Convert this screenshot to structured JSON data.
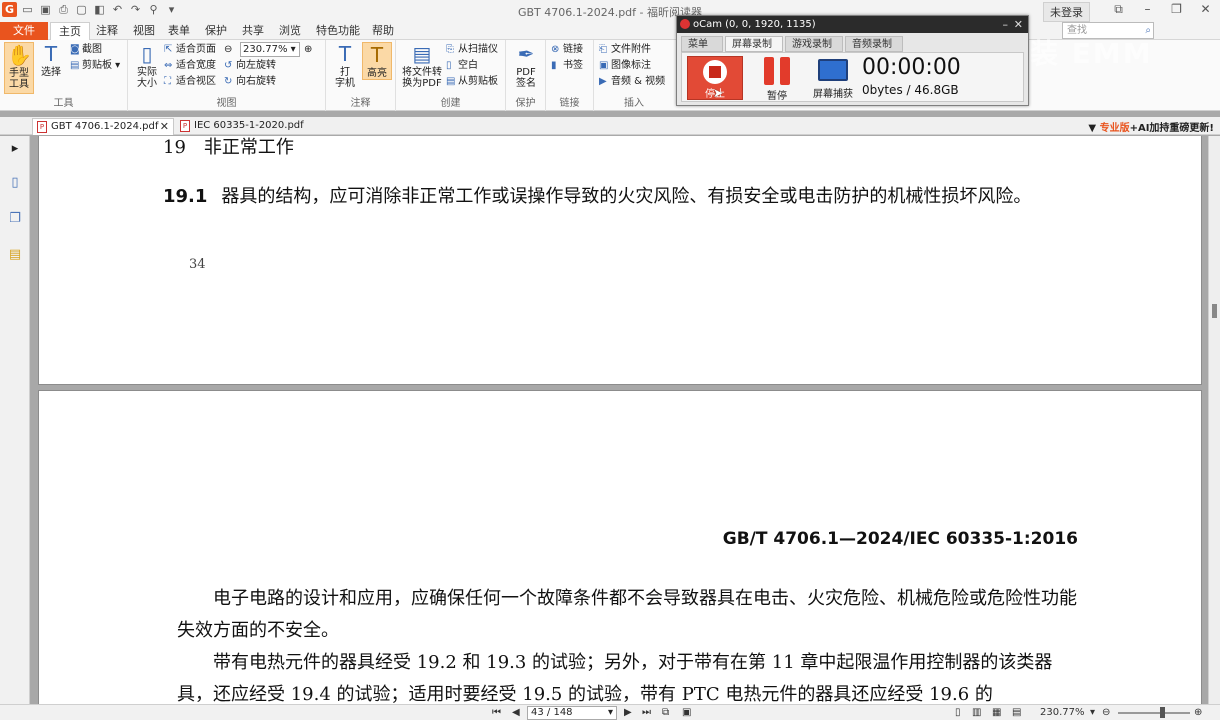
{
  "titlebar": {
    "title": "GBT 4706.1-2024.pdf - 福昕阅读器",
    "login": "未登录"
  },
  "menu": {
    "tabs": [
      "文件",
      "主页",
      "注释",
      "视图",
      "表单",
      "保护",
      "共享",
      "浏览",
      "特色功能",
      "帮助"
    ],
    "search_placeholder": "查找"
  },
  "ribbon": {
    "tools": {
      "hand": "手型\n工具",
      "select": "选择",
      "screenshot": "截图",
      "clipboard": "剪贴板",
      "label": "工具"
    },
    "view": {
      "actual": "实际\n大小",
      "fit_page": "适合页面",
      "fit_width": "适合宽度",
      "fit_visible": "适合视区",
      "zoom": "230.77%",
      "rotate_left": "向左旋转",
      "rotate_right": "向右旋转",
      "label": "视图"
    },
    "annot": {
      "typewriter": "打\n字机",
      "highlight": "高亮",
      "label": "注释"
    },
    "create": {
      "convert": "将文件转\n换为PDF",
      "scanner": "从扫描仪",
      "blank": "空白",
      "from_clip": "从剪贴板",
      "label": "创建"
    },
    "protect": {
      "sign": "PDF\n签名",
      "label": "保护"
    },
    "links": {
      "link": "链接",
      "bookmark": "书签",
      "label": "链接"
    },
    "insert": {
      "attach": "文件附件",
      "image": "图像标注",
      "audio": "音频 & 视频",
      "label": "插入"
    }
  },
  "doctabs": {
    "tab1": "GBT 4706.1-2024.pdf",
    "tab2": "IEC 60335-1-2020.pdf",
    "promo_a": "专业版",
    "promo_b": "+AI加持重磅更新!"
  },
  "page1": {
    "heading": "19　非正常工作",
    "clause_num": "19.1",
    "clause_text": "器具的结构，应可消除非正常工作或误操作导致的火灾风险、有损安全或电击防护的机械性损坏风险。",
    "page_number": "34"
  },
  "page2": {
    "standard": "GB/T 4706.1—2024/IEC 60335-1:2016",
    "para1": "电子电路的设计和应用，应确保任何一个故障条件都不会导致器具在电击、火灾危险、机械危险或危险性功能失效方面的不安全。",
    "para2": "带有电热元件的器具经受 19.2 和 19.3 的试验；另外，对于带有在第 11 章中起限温作用控制器的该类器具，还应经受 19.4 的试验；适用时要经受 19.5 的试验，带有 PTC 电热元件的器具还应经受 19.6 的"
  },
  "statusbar": {
    "page": "43 / 148",
    "zoom": "230.77%"
  },
  "ocam": {
    "title": "oCam (0, 0, 1920, 1135)",
    "tabs": [
      "菜单",
      "屏幕录制",
      "游戏录制",
      "音频录制"
    ],
    "stop": "停止",
    "pause": "暂停",
    "capture": "屏幕捕获",
    "timer": "00:00:00",
    "storage": "0bytes / 46.8GB"
  },
  "colors": {
    "accent": "#e9541e",
    "record": "#e24a36"
  }
}
